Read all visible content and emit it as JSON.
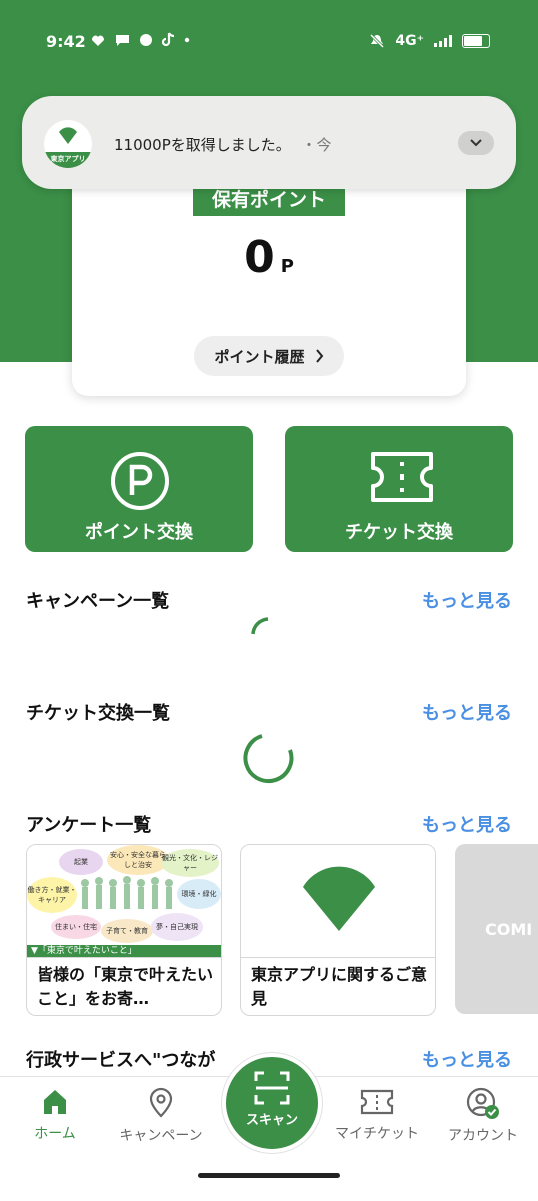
{
  "status_bar": {
    "time": "9:42",
    "network": "4G⁺",
    "left_icons": [
      "weather-icon",
      "chat-icon",
      "sns-icon",
      "tiktok-icon",
      "dot-icon"
    ],
    "right_icons": [
      "mute-icon",
      "signal-icon",
      "battery-icon"
    ]
  },
  "notification": {
    "app_name": "東京アプリ",
    "message": "11000Pを取得しました。",
    "time": "・今"
  },
  "points_card": {
    "badge": "保有ポイント",
    "value": "0",
    "unit": "P",
    "history_button": "ポイント履歴"
  },
  "exchange_tiles": [
    {
      "label": "ポイント交換",
      "icon": "point-p-icon"
    },
    {
      "label": "チケット交換",
      "icon": "ticket-icon"
    }
  ],
  "sections": {
    "campaigns": {
      "title": "キャンペーン一覧",
      "more": "もっと見る"
    },
    "tickets": {
      "title": "チケット交換一覧",
      "more": "もっと見る"
    },
    "surveys": {
      "title": "アンケート一覧",
      "more": "もっと見る"
    },
    "services": {
      "title": "行政サービスへ\"つなが",
      "more": "もっと見る"
    }
  },
  "survey_cards": [
    {
      "caption": "皆様の「東京で叶えたいこと」をお寄…",
      "banner_text": "▼「東京で叶えたいこと」",
      "bubbles": [
        "起業",
        "安心・安全な暮らしと治安",
        "観光・文化・レジャー",
        "働き方・就業・キャリア",
        "環境・緑化",
        "住まい・住宅",
        "子育て・教育",
        "夢・自己実現"
      ]
    },
    {
      "caption": "東京アプリに関するご意見"
    }
  ],
  "coming_card": {
    "label": "COMI"
  },
  "bottom_nav": {
    "items": [
      {
        "label": "ホーム",
        "icon": "home-icon"
      },
      {
        "label": "キャンペーン",
        "icon": "location-pin-icon"
      },
      {
        "label": "マイチケット",
        "icon": "ticket-icon"
      },
      {
        "label": "アカウント",
        "icon": "account-icon"
      }
    ],
    "scan": {
      "label": "スキャン",
      "icon": "scan-icon"
    }
  },
  "colors": {
    "brand_green": "#3b8f47",
    "link_blue": "#4a90e2",
    "notification_bg": "#ecedea"
  }
}
